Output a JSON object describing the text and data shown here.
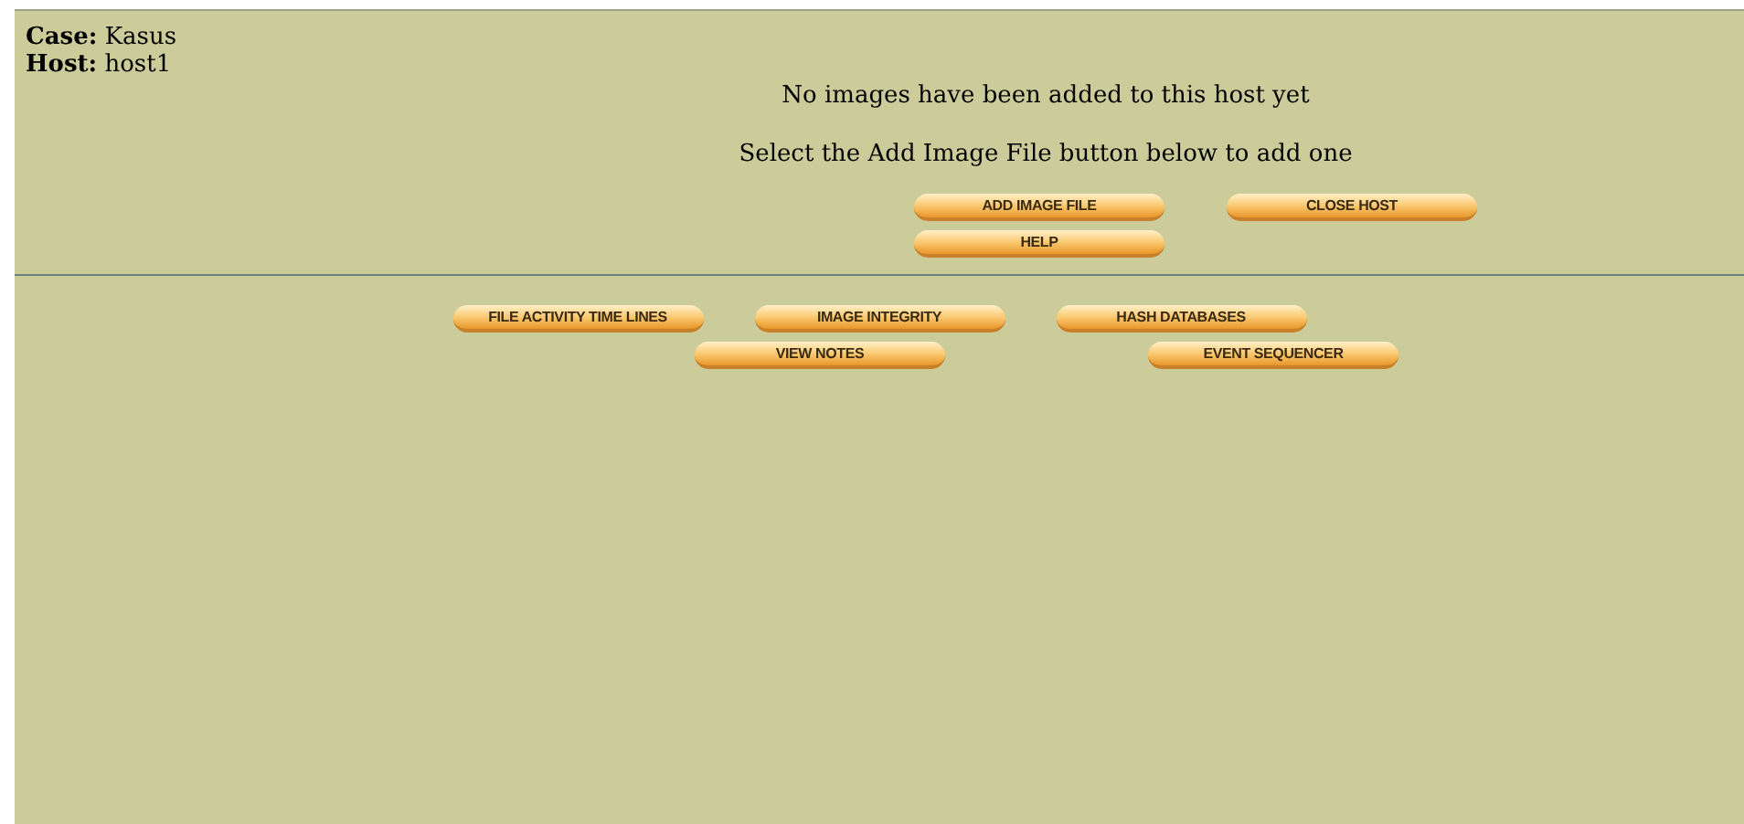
{
  "header": {
    "case_label": "Case:",
    "case_value": "Kasus",
    "host_label": "Host:",
    "host_value": "host1"
  },
  "messages": [
    "No images have been added to this host yet",
    "Select the Add Image File button below to add one"
  ],
  "host_buttons": [
    [
      "ADD IMAGE FILE",
      "CLOSE HOST"
    ],
    [
      "HELP"
    ]
  ],
  "tool_buttons": [
    [
      "FILE ACTIVITY TIME LINES",
      "IMAGE INTEGRITY",
      "HASH DATABASES"
    ],
    [
      "VIEW NOTES",
      "EVENT SEQUENCER"
    ]
  ]
}
